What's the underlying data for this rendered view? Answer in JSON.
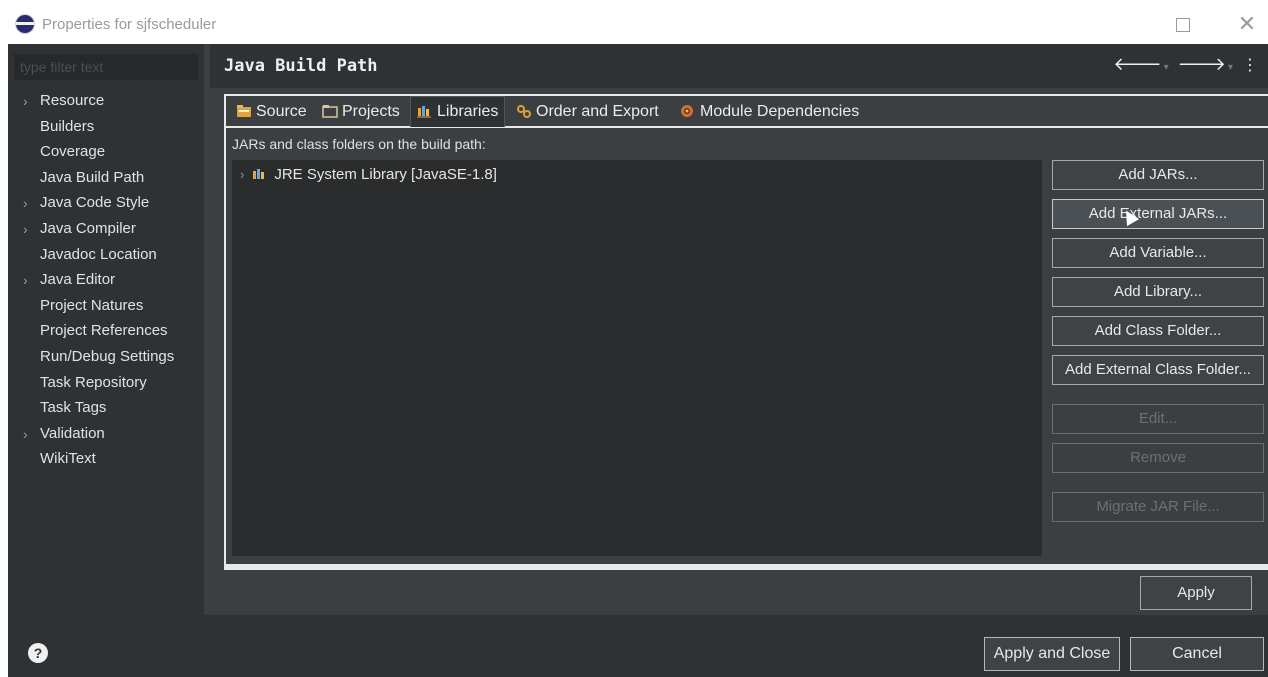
{
  "window": {
    "title": "Properties for sjfscheduler",
    "maximize_icon": "maximize-icon",
    "close_glyph": "✕"
  },
  "sidebar": {
    "filter_placeholder": "type filter text",
    "items": [
      {
        "label": "Resource",
        "expandable": true
      },
      {
        "label": "Builders",
        "expandable": false
      },
      {
        "label": "Coverage",
        "expandable": false
      },
      {
        "label": "Java Build Path",
        "expandable": false
      },
      {
        "label": "Java Code Style",
        "expandable": true
      },
      {
        "label": "Java Compiler",
        "expandable": true
      },
      {
        "label": "Javadoc Location",
        "expandable": false
      },
      {
        "label": "Java Editor",
        "expandable": true
      },
      {
        "label": "Project Natures",
        "expandable": false
      },
      {
        "label": "Project References",
        "expandable": false
      },
      {
        "label": "Run/Debug Settings",
        "expandable": false
      },
      {
        "label": "Task Repository",
        "expandable": false
      },
      {
        "label": "Task Tags",
        "expandable": false
      },
      {
        "label": "Validation",
        "expandable": true
      },
      {
        "label": "WikiText",
        "expandable": false
      }
    ]
  },
  "page": {
    "title": "Java Build Path"
  },
  "tabs": [
    {
      "label": "Source",
      "icon": "source-folder-icon"
    },
    {
      "label": "Projects",
      "icon": "projects-icon"
    },
    {
      "label": "Libraries",
      "icon": "libraries-icon",
      "active": true
    },
    {
      "label": "Order and Export",
      "icon": "order-export-icon"
    },
    {
      "label": "Module Dependencies",
      "icon": "module-dependencies-icon"
    }
  ],
  "libraries": {
    "label": "JARs and class folders on the build path:",
    "items": [
      {
        "label": "JRE System Library [JavaSE-1.8]"
      }
    ]
  },
  "buttons": {
    "add_jars": "Add JARs...",
    "add_external_jars": "Add External JARs...",
    "add_variable": "Add Variable...",
    "add_library": "Add Library...",
    "add_class_folder": "Add Class Folder...",
    "add_external_class_folder": "Add External Class Folder...",
    "edit": "Edit...",
    "remove": "Remove",
    "migrate_jar": "Migrate JAR File...",
    "apply": "Apply"
  },
  "footer": {
    "help_glyph": "?",
    "apply_and_close": "Apply and Close",
    "cancel": "Cancel"
  }
}
